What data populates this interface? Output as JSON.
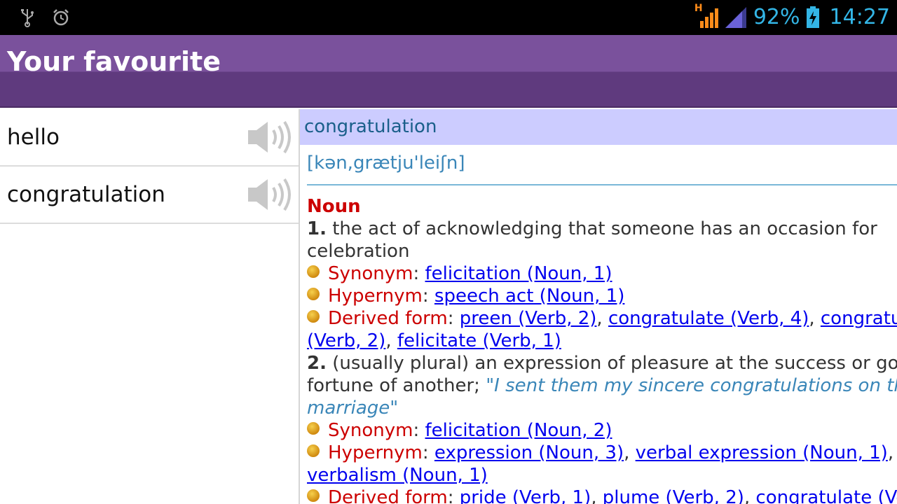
{
  "status_bar": {
    "icons_left": [
      "usb-icon",
      "alarm-icon"
    ],
    "network": "H",
    "battery_percent": "92%",
    "time": "14:27",
    "accent_color": "#33b5e5"
  },
  "app": {
    "title": "Your favourite"
  },
  "favourites": [
    {
      "word": "hello"
    },
    {
      "word": "congratulation"
    }
  ],
  "entry": {
    "headword": "congratulation",
    "phonetic": "[kən,grætju'leiʃn]",
    "pos": "Noun",
    "senses": [
      {
        "num": "1.",
        "definition": "the act of acknowledging that someone has an occasion for",
        "definition_cont": "celebration",
        "synonym_label": "Synonym",
        "synonym_links": [
          "felicitation (Noun, 1)"
        ],
        "hypernym_label": "Hypernym",
        "hypernym_links": [
          "speech act (Noun, 1)"
        ],
        "derived_label": "Derived form",
        "derived_links": [
          "preen (Verb, 2)",
          "congratulate (Verb, 4)",
          "congratulate",
          "(Verb, 2)",
          "felicitate (Verb, 1)"
        ]
      },
      {
        "num": "2.",
        "definition": "(usually plural) an expression of pleasure at the success or good",
        "definition_cont": "fortune of another; ",
        "example": "\"I sent them my sincere congratulations on their",
        "example_cont": "marriage\"",
        "synonym_label": "Synonym",
        "synonym_links": [
          "felicitation (Noun, 2)"
        ],
        "hypernym_label": "Hypernym",
        "hypernym_links": [
          "expression (Noun, 3)",
          "verbal expression (Noun, 1)",
          "verbalism (Noun, 1)"
        ],
        "derived_label": "Derived form",
        "derived_links": [
          "pride (Verb, 1)",
          "plume (Verb, 2)",
          "congratulate (Verb,"
        ]
      }
    ]
  }
}
